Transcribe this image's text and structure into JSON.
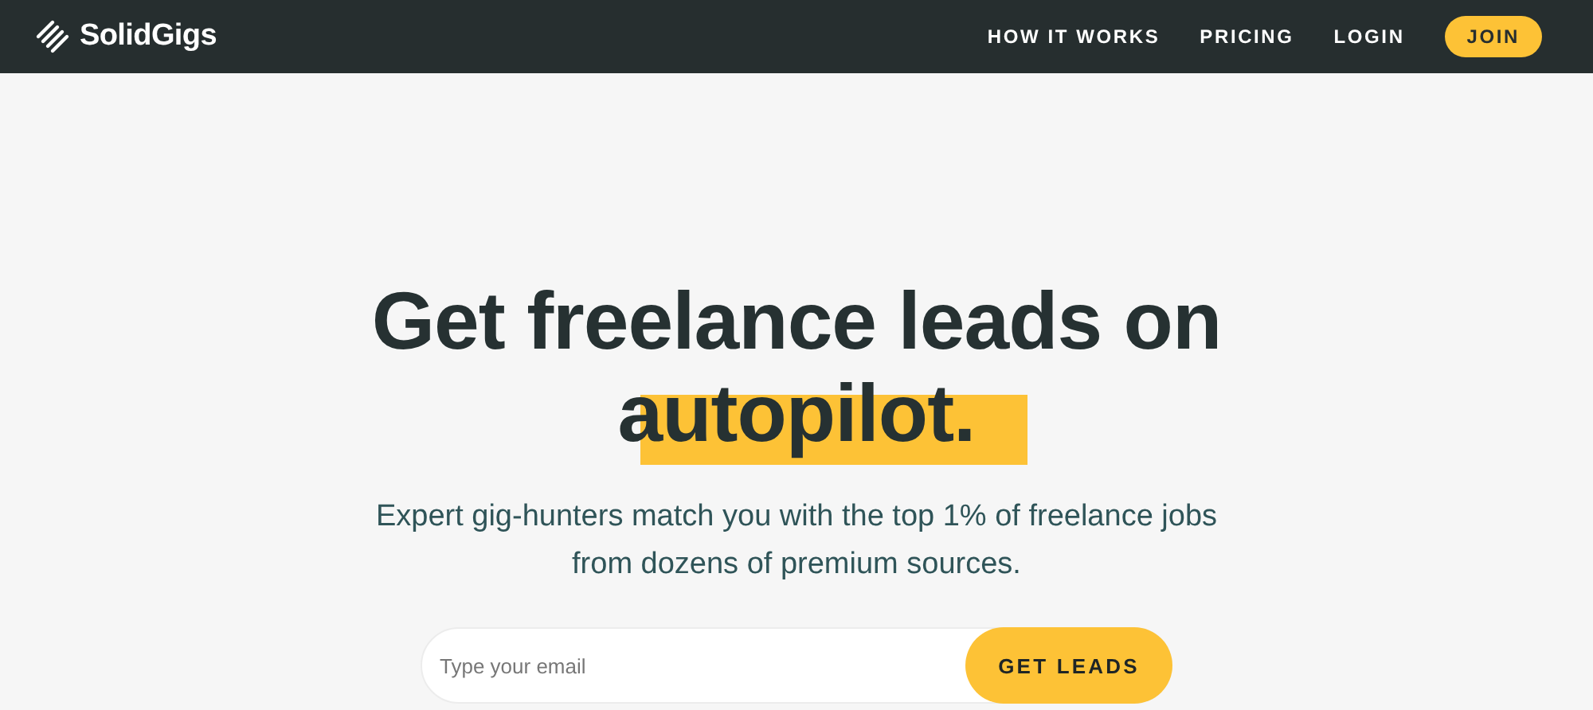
{
  "brand": {
    "name": "SolidGigs"
  },
  "nav": [
    {
      "label": "HOW IT WORKS",
      "kind": "link"
    },
    {
      "label": "PRICING",
      "kind": "link"
    },
    {
      "label": "LOGIN",
      "kind": "link"
    },
    {
      "label": "JOIN",
      "kind": "button"
    }
  ],
  "hero": {
    "headline": "Get freelance leads on",
    "highlight": "autopilot.",
    "subtitle": "Expert gig-hunters match you with the top 1% of freelance jobs from dozens of premium sources.",
    "email": {
      "placeholder": "Type your email"
    },
    "button": "GET LEADS"
  }
}
